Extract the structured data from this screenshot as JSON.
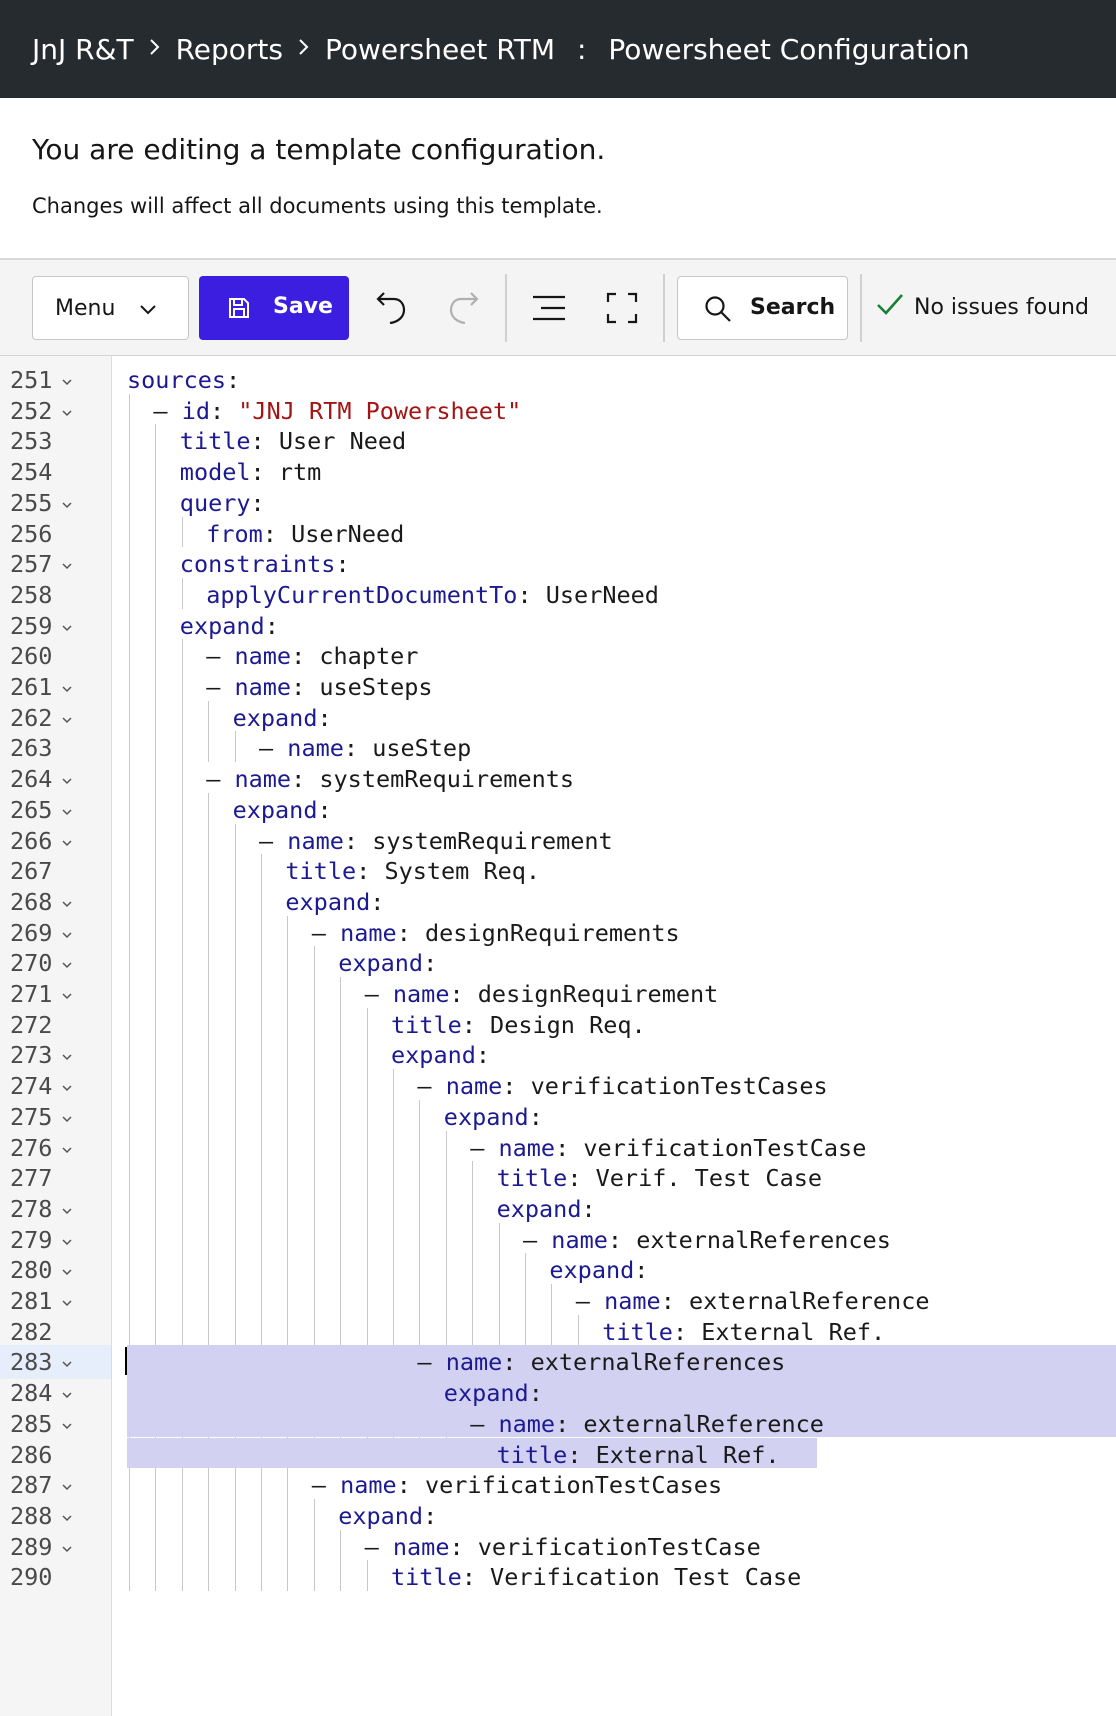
{
  "header": {
    "breadcrumbs": [
      "JnJ R&T",
      "Reports",
      "Powersheet RTM"
    ],
    "page_title": "Powersheet Configuration"
  },
  "notice": {
    "title": "You are editing a template configuration.",
    "subtitle": "Changes will affect all documents using this template."
  },
  "toolbar": {
    "menu_label": "Menu",
    "save_label": "Save",
    "search_label": "Search",
    "status_text": "No issues found",
    "accent_color": "#3b1ee0",
    "status_color": "#198038"
  },
  "editor": {
    "active_line": 283,
    "selection": {
      "from_line": 283,
      "to_line": 286
    },
    "lines": [
      {
        "n": "251",
        "fold": true,
        "indent": 0,
        "key": "sources",
        "sep": ":",
        "value": ""
      },
      {
        "n": "252",
        "fold": true,
        "indent": 1,
        "dash": true,
        "key": "id",
        "sep": ": ",
        "value": "\"JNJ RTM Powersheet\"",
        "string": true
      },
      {
        "n": "253",
        "fold": false,
        "indent": 2,
        "key": "title",
        "sep": ": ",
        "value": "User Need"
      },
      {
        "n": "254",
        "fold": false,
        "indent": 2,
        "key": "model",
        "sep": ": ",
        "value": "rtm"
      },
      {
        "n": "255",
        "fold": true,
        "indent": 2,
        "key": "query",
        "sep": ":",
        "value": ""
      },
      {
        "n": "256",
        "fold": false,
        "indent": 3,
        "key": "from",
        "sep": ": ",
        "value": "UserNeed"
      },
      {
        "n": "257",
        "fold": true,
        "indent": 2,
        "key": "constraints",
        "sep": ":",
        "value": ""
      },
      {
        "n": "258",
        "fold": false,
        "indent": 3,
        "key": "applyCurrentDocumentTo",
        "sep": ": ",
        "value": "UserNeed"
      },
      {
        "n": "259",
        "fold": true,
        "indent": 2,
        "key": "expand",
        "sep": ":",
        "value": ""
      },
      {
        "n": "260",
        "fold": false,
        "indent": 3,
        "dash": true,
        "key": "name",
        "sep": ": ",
        "value": "chapter"
      },
      {
        "n": "261",
        "fold": true,
        "indent": 3,
        "dash": true,
        "key": "name",
        "sep": ": ",
        "value": "useSteps"
      },
      {
        "n": "262",
        "fold": true,
        "indent": 4,
        "key": "expand",
        "sep": ":",
        "value": ""
      },
      {
        "n": "263",
        "fold": false,
        "indent": 5,
        "dash": true,
        "key": "name",
        "sep": ": ",
        "value": "useStep"
      },
      {
        "n": "264",
        "fold": true,
        "indent": 3,
        "dash": true,
        "key": "name",
        "sep": ": ",
        "value": "systemRequirements"
      },
      {
        "n": "265",
        "fold": true,
        "indent": 4,
        "key": "expand",
        "sep": ":",
        "value": ""
      },
      {
        "n": "266",
        "fold": true,
        "indent": 5,
        "dash": true,
        "key": "name",
        "sep": ": ",
        "value": "systemRequirement"
      },
      {
        "n": "267",
        "fold": false,
        "indent": 6,
        "key": "title",
        "sep": ": ",
        "value": "System Req."
      },
      {
        "n": "268",
        "fold": true,
        "indent": 6,
        "key": "expand",
        "sep": ":",
        "value": ""
      },
      {
        "n": "269",
        "fold": true,
        "indent": 7,
        "dash": true,
        "key": "name",
        "sep": ": ",
        "value": "designRequirements"
      },
      {
        "n": "270",
        "fold": true,
        "indent": 8,
        "key": "expand",
        "sep": ":",
        "value": ""
      },
      {
        "n": "271",
        "fold": true,
        "indent": 9,
        "dash": true,
        "key": "name",
        "sep": ": ",
        "value": "designRequirement"
      },
      {
        "n": "272",
        "fold": false,
        "indent": 10,
        "key": "title",
        "sep": ": ",
        "value": "Design Req."
      },
      {
        "n": "273",
        "fold": true,
        "indent": 10,
        "key": "expand",
        "sep": ":",
        "value": ""
      },
      {
        "n": "274",
        "fold": true,
        "indent": 11,
        "dash": true,
        "key": "name",
        "sep": ": ",
        "value": "verificationTestCases"
      },
      {
        "n": "275",
        "fold": true,
        "indent": 12,
        "key": "expand",
        "sep": ":",
        "value": ""
      },
      {
        "n": "276",
        "fold": true,
        "indent": 13,
        "dash": true,
        "key": "name",
        "sep": ": ",
        "value": "verificationTestCase"
      },
      {
        "n": "277",
        "fold": false,
        "indent": 14,
        "key": "title",
        "sep": ": ",
        "value": "Verif. Test Case"
      },
      {
        "n": "278",
        "fold": true,
        "indent": 14,
        "key": "expand",
        "sep": ":",
        "value": ""
      },
      {
        "n": "279",
        "fold": true,
        "indent": 15,
        "dash": true,
        "key": "name",
        "sep": ": ",
        "value": "externalReferences"
      },
      {
        "n": "280",
        "fold": true,
        "indent": 16,
        "key": "expand",
        "sep": ":",
        "value": ""
      },
      {
        "n": "281",
        "fold": true,
        "indent": 17,
        "dash": true,
        "key": "name",
        "sep": ": ",
        "value": "externalReference"
      },
      {
        "n": "282",
        "fold": false,
        "indent": 18,
        "key": "title",
        "sep": ": ",
        "value": "External Ref."
      },
      {
        "n": "283",
        "fold": true,
        "indent": 11,
        "dash": true,
        "key": "name",
        "sep": ": ",
        "value": "externalReferences"
      },
      {
        "n": "284",
        "fold": true,
        "indent": 12,
        "key": "expand",
        "sep": ":",
        "value": ""
      },
      {
        "n": "285",
        "fold": true,
        "indent": 13,
        "dash": true,
        "key": "name",
        "sep": ": ",
        "value": "externalReference"
      },
      {
        "n": "286",
        "fold": false,
        "indent": 14,
        "key": "title",
        "sep": ": ",
        "value": "External Ref."
      },
      {
        "n": "287",
        "fold": true,
        "indent": 7,
        "dash": true,
        "key": "name",
        "sep": ": ",
        "value": "verificationTestCases"
      },
      {
        "n": "288",
        "fold": true,
        "indent": 8,
        "key": "expand",
        "sep": ":",
        "value": ""
      },
      {
        "n": "289",
        "fold": true,
        "indent": 9,
        "dash": true,
        "key": "name",
        "sep": ": ",
        "value": "verificationTestCase"
      },
      {
        "n": "290",
        "fold": false,
        "indent": 10,
        "key": "title",
        "sep": ": ",
        "value": "Verification Test Case"
      }
    ]
  }
}
